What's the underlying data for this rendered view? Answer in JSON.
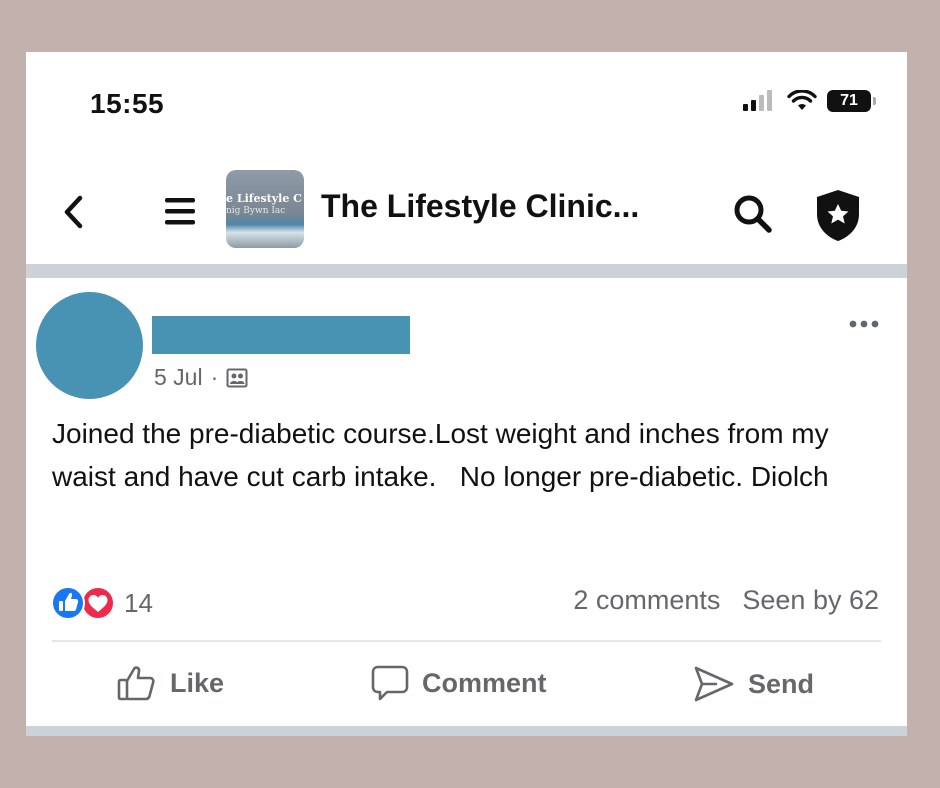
{
  "status_bar": {
    "time": "15:55",
    "battery": "71"
  },
  "header": {
    "page_title": "The Lifestyle Clinic...",
    "thumb_line1": "e Lifestyle C",
    "thumb_line2": "nig Bywn Iac"
  },
  "post": {
    "date": "5 Jul",
    "separator": "·",
    "text": "Joined the pre-diabetic course.Lost weight and inches from my waist and have cut carb intake.   No longer pre-diabetic. Diolch",
    "reaction_count": "14",
    "comments": "2 comments",
    "seen_by": "Seen by 62"
  },
  "actions": {
    "like": "Like",
    "comment": "Comment",
    "send": "Send"
  },
  "colors": {
    "background": "#c3b1ad",
    "redaction": "#4892b3",
    "like_blue": "#1877f2",
    "love_red": "#f02849"
  }
}
